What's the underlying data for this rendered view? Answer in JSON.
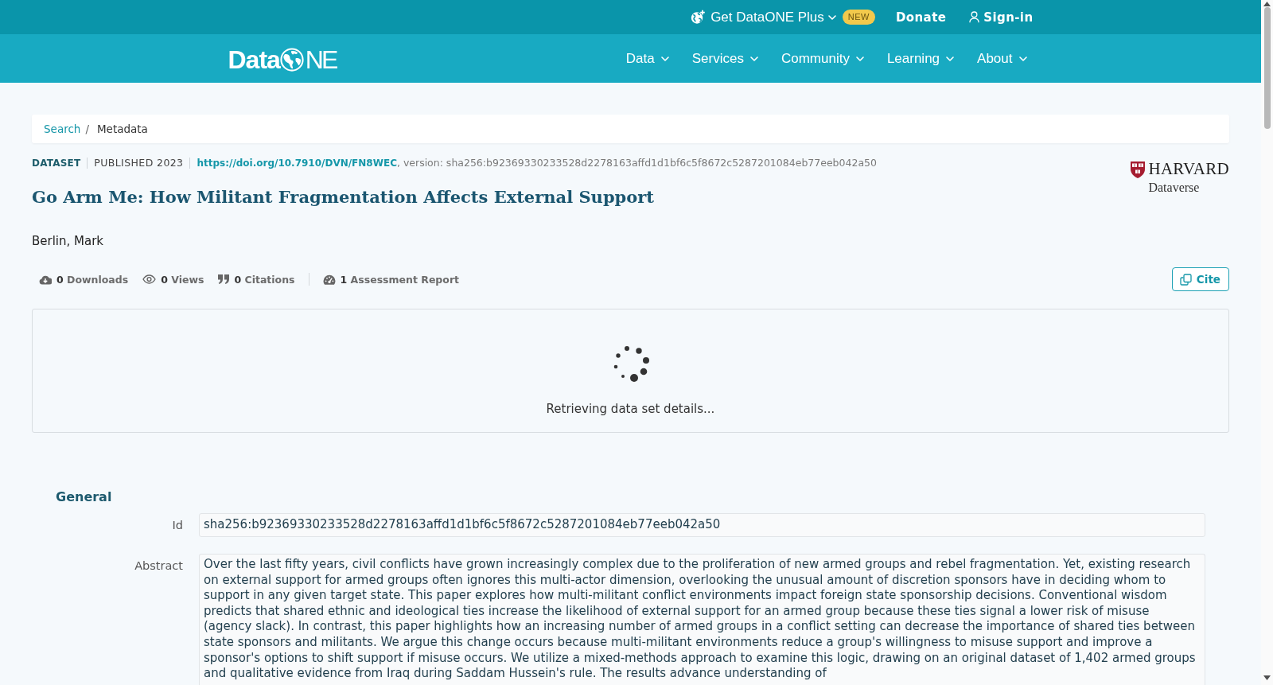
{
  "top_bar": {
    "plus_menu": "Get DataONE Plus",
    "badge": "NEW",
    "donate": "Donate",
    "sign_in": "Sign-in"
  },
  "logo": {
    "lead": "Data",
    "tail": "NE"
  },
  "nav": [
    {
      "label": "Data"
    },
    {
      "label": "Services"
    },
    {
      "label": "Community"
    },
    {
      "label": "Learning"
    },
    {
      "label": "About"
    }
  ],
  "breadcrumb": {
    "separator": "/",
    "items": [
      {
        "kind": "link",
        "label": "Search"
      },
      {
        "kind": "current",
        "label": "Metadata"
      }
    ]
  },
  "dataset": {
    "type": "DATASET",
    "published": "PUBLISHED 2023",
    "doi": "https://doi.org/10.7910/DVN/FN8WEC",
    "version_note": ", version: sha256:b92369330233528d2278163affd1d1bf6c5f8672c5287201084eb77eeb042a50",
    "title": "Go Arm Me: How Militant Fragmentation Affects External Support",
    "authors": [
      "Berlin, Mark"
    ]
  },
  "repository_logo": {
    "name": "HARVARD",
    "subtitle": "Dataverse"
  },
  "metrics": [
    {
      "kind": "downloads",
      "text": "**0** Downloads"
    },
    {
      "kind": "views",
      "text": "**0** Views"
    },
    {
      "kind": "citations",
      "text": "**0** Citations"
    }
  ],
  "assessment": {
    "text": "**1** Assessment Report"
  },
  "cite_button": "Cite",
  "loading": {
    "message": "Retrieving data set details..."
  },
  "general": {
    "heading": "General",
    "fields": [
      {
        "kind": "line",
        "label": "Id",
        "value": "sha256:b92369330233528d2278163affd1d1bf6c5f8672c5287201084eb77eeb042a50"
      },
      {
        "kind": "text",
        "label": "Abstract",
        "value": "Over the last fifty years, civil conflicts have grown increasingly complex due to the proliferation of new armed groups and rebel fragmentation. Yet, existing research on external support for armed groups often ignores this multi-actor dimension, overlooking the unusual amount of discretion sponsors have in deciding whom to support in any given target state. This paper explores how multi-militant conflict environments impact foreign state sponsorship decisions. Conventional wisdom predicts that shared ethnic and ideological ties increase the likelihood of external support for an armed group because these ties signal a lower risk of misuse (agency slack). In contrast, this paper highlights how an increasing number of armed groups in a conflict setting can decrease the importance of shared ties between state sponsors and militants. We argue this change occurs because multi-militant environments reduce a group's willingness to misuse support and improve a sponsor's options to shift support if misuse occurs. We utilize a mixed-methods approach to examine this logic, drawing on an original dataset of 1,402 armed groups and qualitative evidence from Iraq during Saddam Hussein's rule. The results advance understanding of"
      }
    ]
  }
}
